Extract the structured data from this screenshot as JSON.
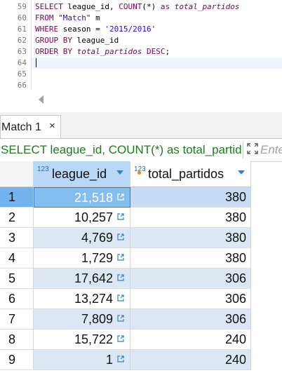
{
  "editor": {
    "lines": [
      {
        "num": "59",
        "segments": [
          [
            "kw",
            "SELECT "
          ],
          [
            "fn",
            "league_id, "
          ],
          [
            "kw",
            "COUNT"
          ],
          [
            "fn",
            "(*) "
          ],
          [
            "kw",
            "as "
          ],
          [
            "it",
            "total_partidos"
          ]
        ]
      },
      {
        "num": "60",
        "segments": [
          [
            "kw",
            "FROM "
          ],
          [
            "str",
            "\"Match\""
          ],
          [
            "fn",
            " m"
          ]
        ]
      },
      {
        "num": "61",
        "segments": [
          [
            "kw",
            "WHERE "
          ],
          [
            "fn",
            "season = "
          ],
          [
            "str",
            "'2015/2016'"
          ]
        ]
      },
      {
        "num": "62",
        "segments": [
          [
            "kw",
            "GROUP BY "
          ],
          [
            "fn",
            "league_id"
          ]
        ]
      },
      {
        "num": "63",
        "segments": [
          [
            "kw",
            "ORDER BY "
          ],
          [
            "it",
            "total_partidos "
          ],
          [
            "kw",
            "DESC"
          ],
          [
            "fn",
            ";"
          ]
        ]
      },
      {
        "num": "64",
        "segments": []
      },
      {
        "num": "65",
        "segments": []
      },
      {
        "num": "66",
        "segments": []
      }
    ]
  },
  "results": {
    "tab_label": "Match 1",
    "tab_close": "×",
    "filter_text": "SELECT league_id, COUNT(*) as total_partidos",
    "filter_placeholder": "Ente",
    "columns": [
      {
        "type_badge": "123",
        "name": "league_id"
      },
      {
        "type_badge": "123",
        "name": "total_partidos"
      }
    ],
    "rows": [
      {
        "num": "1",
        "league_id": "21,518",
        "total_partidos": "380"
      },
      {
        "num": "2",
        "league_id": "10,257",
        "total_partidos": "380"
      },
      {
        "num": "3",
        "league_id": "4,769",
        "total_partidos": "380"
      },
      {
        "num": "4",
        "league_id": "1,729",
        "total_partidos": "380"
      },
      {
        "num": "5",
        "league_id": "17,642",
        "total_partidos": "306"
      },
      {
        "num": "6",
        "league_id": "13,274",
        "total_partidos": "306"
      },
      {
        "num": "7",
        "league_id": "7,809",
        "total_partidos": "306"
      },
      {
        "num": "8",
        "league_id": "15,722",
        "total_partidos": "240"
      },
      {
        "num": "9",
        "league_id": "1",
        "total_partidos": "240"
      }
    ]
  },
  "colors": {
    "keyword": "#7f0055",
    "string": "#2a00ff",
    "selection": "#84bdf0",
    "filter_text": "#1d7a1d"
  }
}
